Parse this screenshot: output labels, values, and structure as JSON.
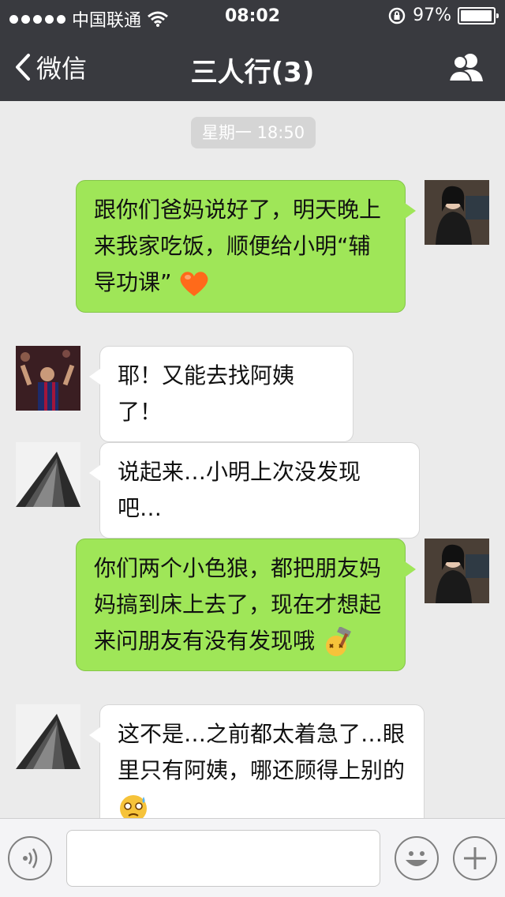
{
  "status_bar": {
    "carrier": "中国联通",
    "time": "08:02",
    "battery": "97%",
    "battery_level": 0.97
  },
  "nav": {
    "back_label": "微信",
    "title": "三人行(3)"
  },
  "chat": {
    "timestamp": "星期一 18:50",
    "messages": [
      {
        "side": "out",
        "text": "跟你们爸妈说好了，明天晚上来我家吃饭，顺便给小明“辅导功课”",
        "emoji": "heart-emoji"
      },
      {
        "side": "in",
        "text": "耶！又能去找阿姨了！"
      },
      {
        "side": "in",
        "text": "说起来…小明上次没发现吧…"
      },
      {
        "side": "out",
        "text": "你们两个小色狼，都把朋友妈妈搞到床上去了，现在才想起来问朋友有没有发现哦",
        "emoji": "hammer-emoji"
      },
      {
        "side": "in",
        "text": "这不是…之前都太着急了…眼里只有阿姨，哪还顾得上别的",
        "emoji": "sweat-emoji"
      }
    ]
  },
  "input_bar": {
    "voice_icon": "voice-icon",
    "emoji_icon": "smiley-icon",
    "add_icon": "plus-icon"
  },
  "colors": {
    "header_bg": "#393a3f",
    "chat_bg": "#ebebeb",
    "outgoing_bubble": "#9fe658",
    "incoming_bubble": "#ffffff"
  }
}
